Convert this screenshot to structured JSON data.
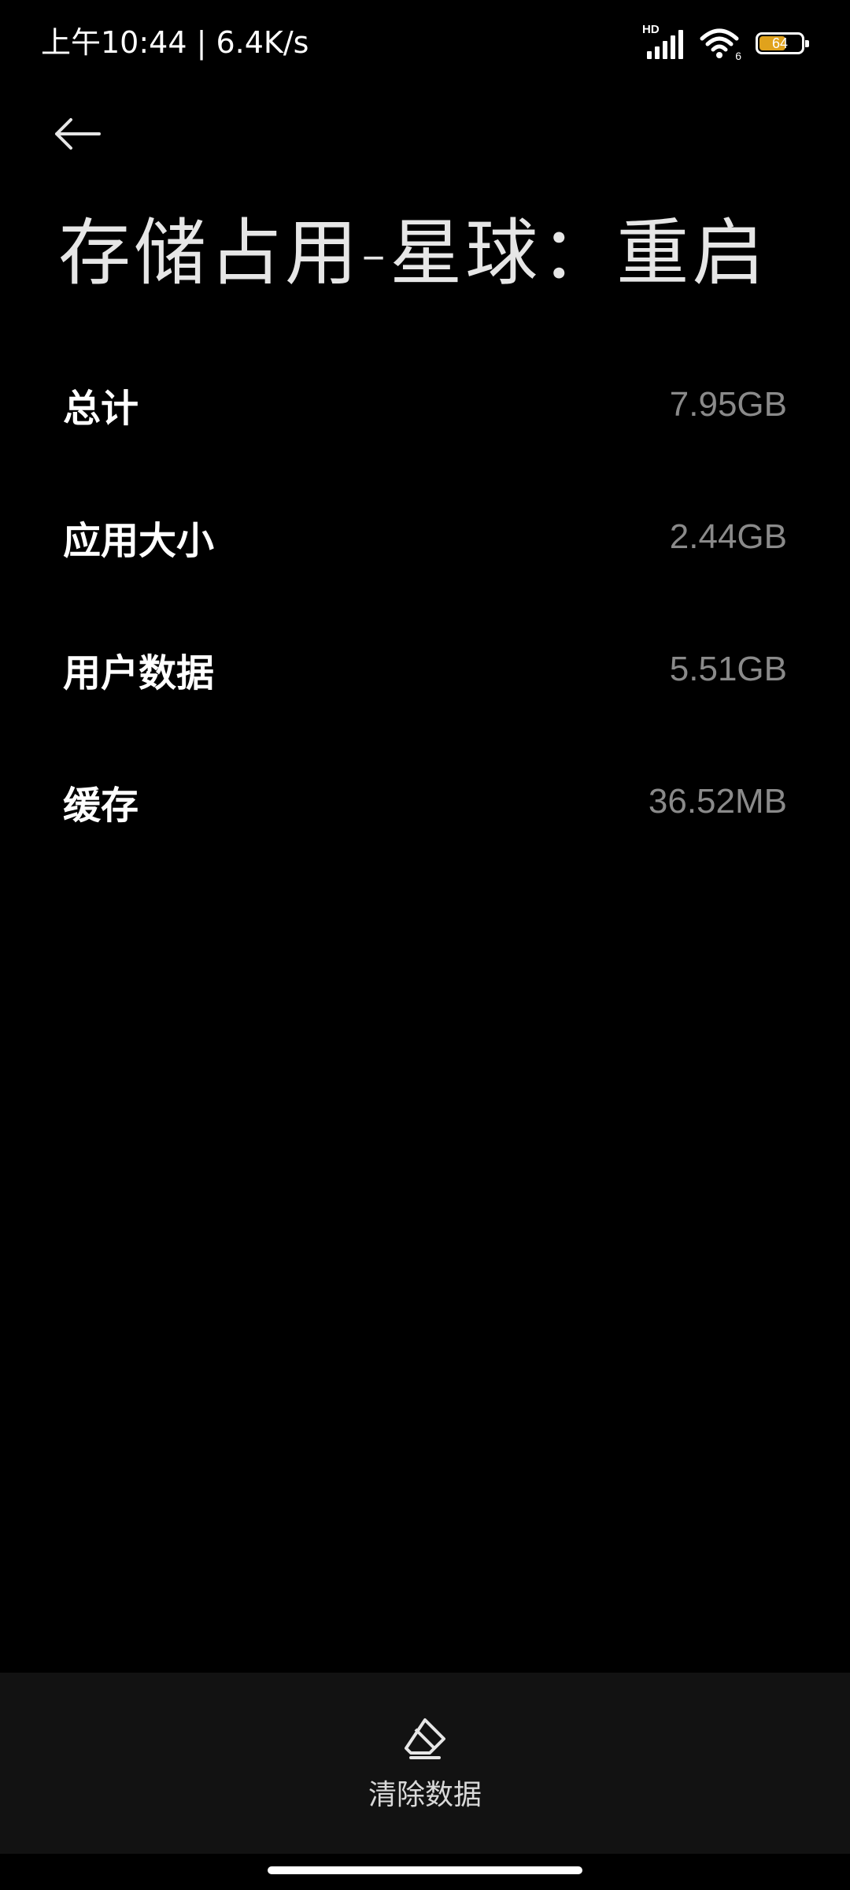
{
  "status_bar": {
    "time_speed": "上午10:44 | 6.4K/s",
    "network_badge": "HD",
    "wifi_badge": "6",
    "battery_level": "64",
    "battery_fraction": 0.64,
    "battery_color": "#e0a21c",
    "icons": [
      "signal-icon",
      "wifi-icon",
      "battery-icon"
    ]
  },
  "header": {
    "back_icon": "back-arrow-icon",
    "title": "存储占用-星球：重启"
  },
  "storage": {
    "rows": [
      {
        "label": "总计",
        "value": "7.95GB"
      },
      {
        "label": "应用大小",
        "value": "2.44GB"
      },
      {
        "label": "用户数据",
        "value": "5.51GB"
      },
      {
        "label": "缓存",
        "value": "36.52MB"
      }
    ]
  },
  "actions": {
    "clear_data_icon": "eraser-icon",
    "clear_data_label": "清除数据"
  }
}
